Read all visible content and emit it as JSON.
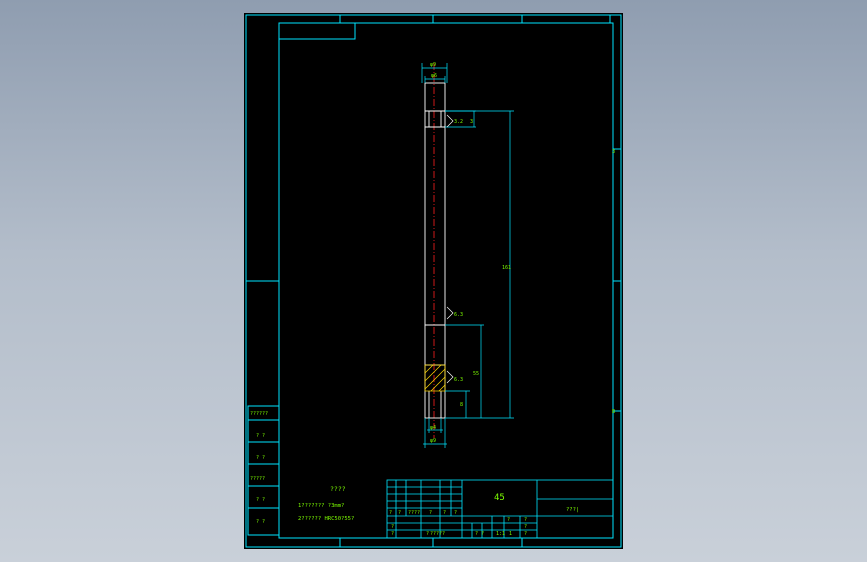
{
  "drawing": {
    "material": "45",
    "part_name": "???|",
    "notes_title": "????",
    "note_1": "1??????? ?3mm?",
    "note_2": "2?????? HRC50?55?",
    "side_labels": [
      "??????",
      "? ?",
      "? ?",
      "?????",
      "? ?",
      "? ?"
    ],
    "dimensions": {
      "top_width": "φ9",
      "head_width": "φ6",
      "step_height": "3",
      "roughness_upper": "3.2",
      "total_length": "161",
      "roughness_mid": "6.3",
      "lower_length": "55",
      "roughness_lower": "6.3",
      "bottom_length": "8",
      "bottom_hole": "φ4",
      "bottom_width": "φ9"
    },
    "title_block": {
      "row_a": [
        "?",
        "?",
        "????",
        "?",
        "?",
        "?"
      ],
      "row_b": [
        "?",
        "?",
        "?"
      ],
      "row_c": [
        "?",
        "?",
        "?",
        "1",
        "?"
      ],
      "scale": "1:1",
      "sheet": "? ?",
      "standard": "?????"
    },
    "zone_marks": [
      "3",
      "4",
      "B"
    ],
    "colors": {
      "frame": "#00e5ff",
      "text": "#7cfc00",
      "centerline": "#ff2020",
      "part": "#ffffff"
    }
  }
}
